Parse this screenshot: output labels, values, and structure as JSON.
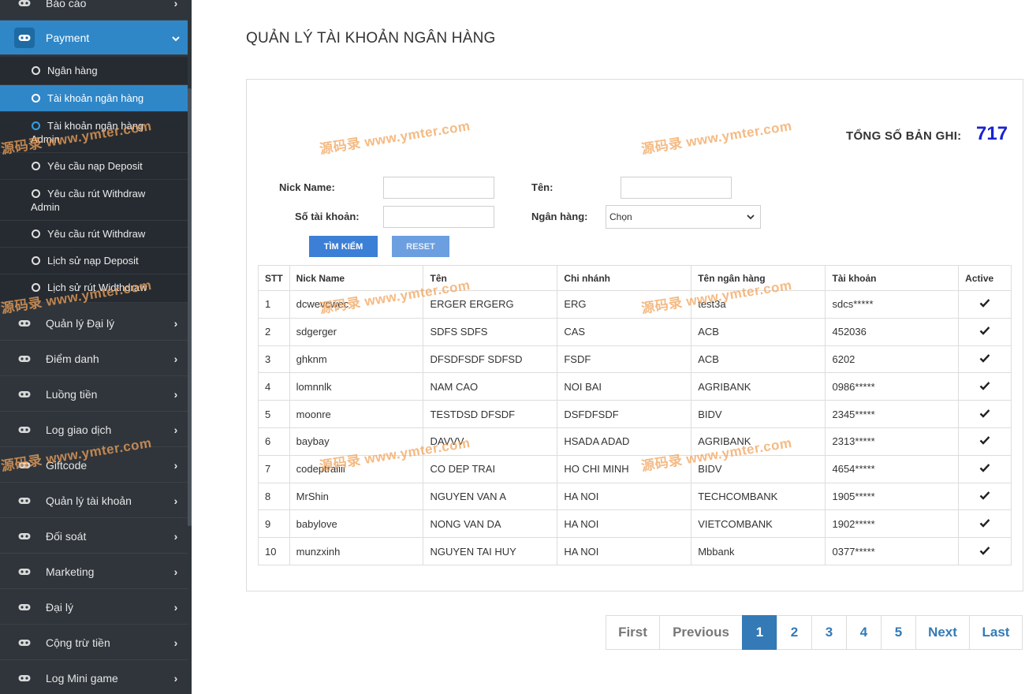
{
  "sidebar": {
    "top_item": "Báo cáo",
    "payment": {
      "label": "Payment"
    },
    "sub_items": [
      "Ngân hàng",
      "Tài khoản ngân hàng",
      "Tài khoản ngân hàng",
      "Admin",
      "Yêu cầu nạp Deposit",
      "Yêu cầu rút Withdraw",
      "Admin",
      "Yêu cầu rút Withdraw",
      "Lịch sử nạp Deposit",
      "Lịch sử rút Widthdraw"
    ],
    "items": [
      "Quản lý Đại lý",
      "Điểm danh",
      "Luồng tiền",
      "Log giao dịch",
      "Giftcode",
      "Quản lý tài khoản",
      "Đối soát",
      "Marketing",
      "Đại lý",
      "Cộng trừ tiền",
      "Log Mini game"
    ]
  },
  "page": {
    "title": "QUẢN LÝ TÀI KHOẢN NGÂN HÀNG",
    "total_label": "TỔNG SỐ BẢN GHI:",
    "total_value": "717"
  },
  "filters": {
    "nick_label": "Nick Name:",
    "name_label": "Tên:",
    "account_label": "Số tài khoản:",
    "bank_label": "Ngân hàng:",
    "bank_selected": "Chọn",
    "search_button": "TÌM KIẾM",
    "reset_button": "RESET"
  },
  "table": {
    "headers": [
      "STT",
      "Nick Name",
      "Tên",
      "Chi nhánh",
      "Tên ngân hàng",
      "Tài khoản",
      "Active"
    ],
    "rows": [
      [
        "1",
        "dcwevcwec",
        "ERGER ERGERG",
        "ERG",
        "test3a",
        "sdcs*****"
      ],
      [
        "2",
        "sdgerger",
        "SDFS SDFS",
        "CAS",
        "ACB",
        "452036"
      ],
      [
        "3",
        "ghknm",
        "DFSDFSDF SDFSD",
        "FSDF",
        "ACB",
        "6202"
      ],
      [
        "4",
        "lomnnlk",
        "NAM CAO",
        "NOI BAI",
        "AGRIBANK",
        "0986*****"
      ],
      [
        "5",
        "moonre",
        "TESTDSD DFSDF",
        "DSFDFSDF",
        "BIDV",
        "2345*****"
      ],
      [
        "6",
        "baybay",
        "DAVVV",
        "HSADA ADAD",
        "AGRIBANK",
        "2313*****"
      ],
      [
        "7",
        "codeptraiiii",
        "CO DEP TRAI",
        "HO CHI MINH",
        "BIDV",
        "4654*****"
      ],
      [
        "8",
        "MrShin",
        "NGUYEN VAN A",
        "HA NOI",
        "TECHCOMBANK",
        "1905*****"
      ],
      [
        "9",
        "babylove",
        "NONG VAN DA",
        "HA NOI",
        "VIETCOMBANK",
        "1902*****"
      ],
      [
        "10",
        "munzxinh",
        "NGUYEN TAI HUY",
        "HA NOI",
        "Mbbank",
        "0377*****"
      ]
    ]
  },
  "pagination": {
    "first": "First",
    "previous": "Previous",
    "pages": [
      "1",
      "2",
      "3",
      "4",
      "5"
    ],
    "current": "1",
    "next": "Next",
    "last": "Last"
  },
  "watermark": {
    "text": "源码录 www.ymter.com"
  },
  "colors": {
    "accent": "#2f87c8",
    "sidebar_bg": "#2f353b",
    "total_value": "#1a21d4",
    "pager": "#337ab7"
  }
}
